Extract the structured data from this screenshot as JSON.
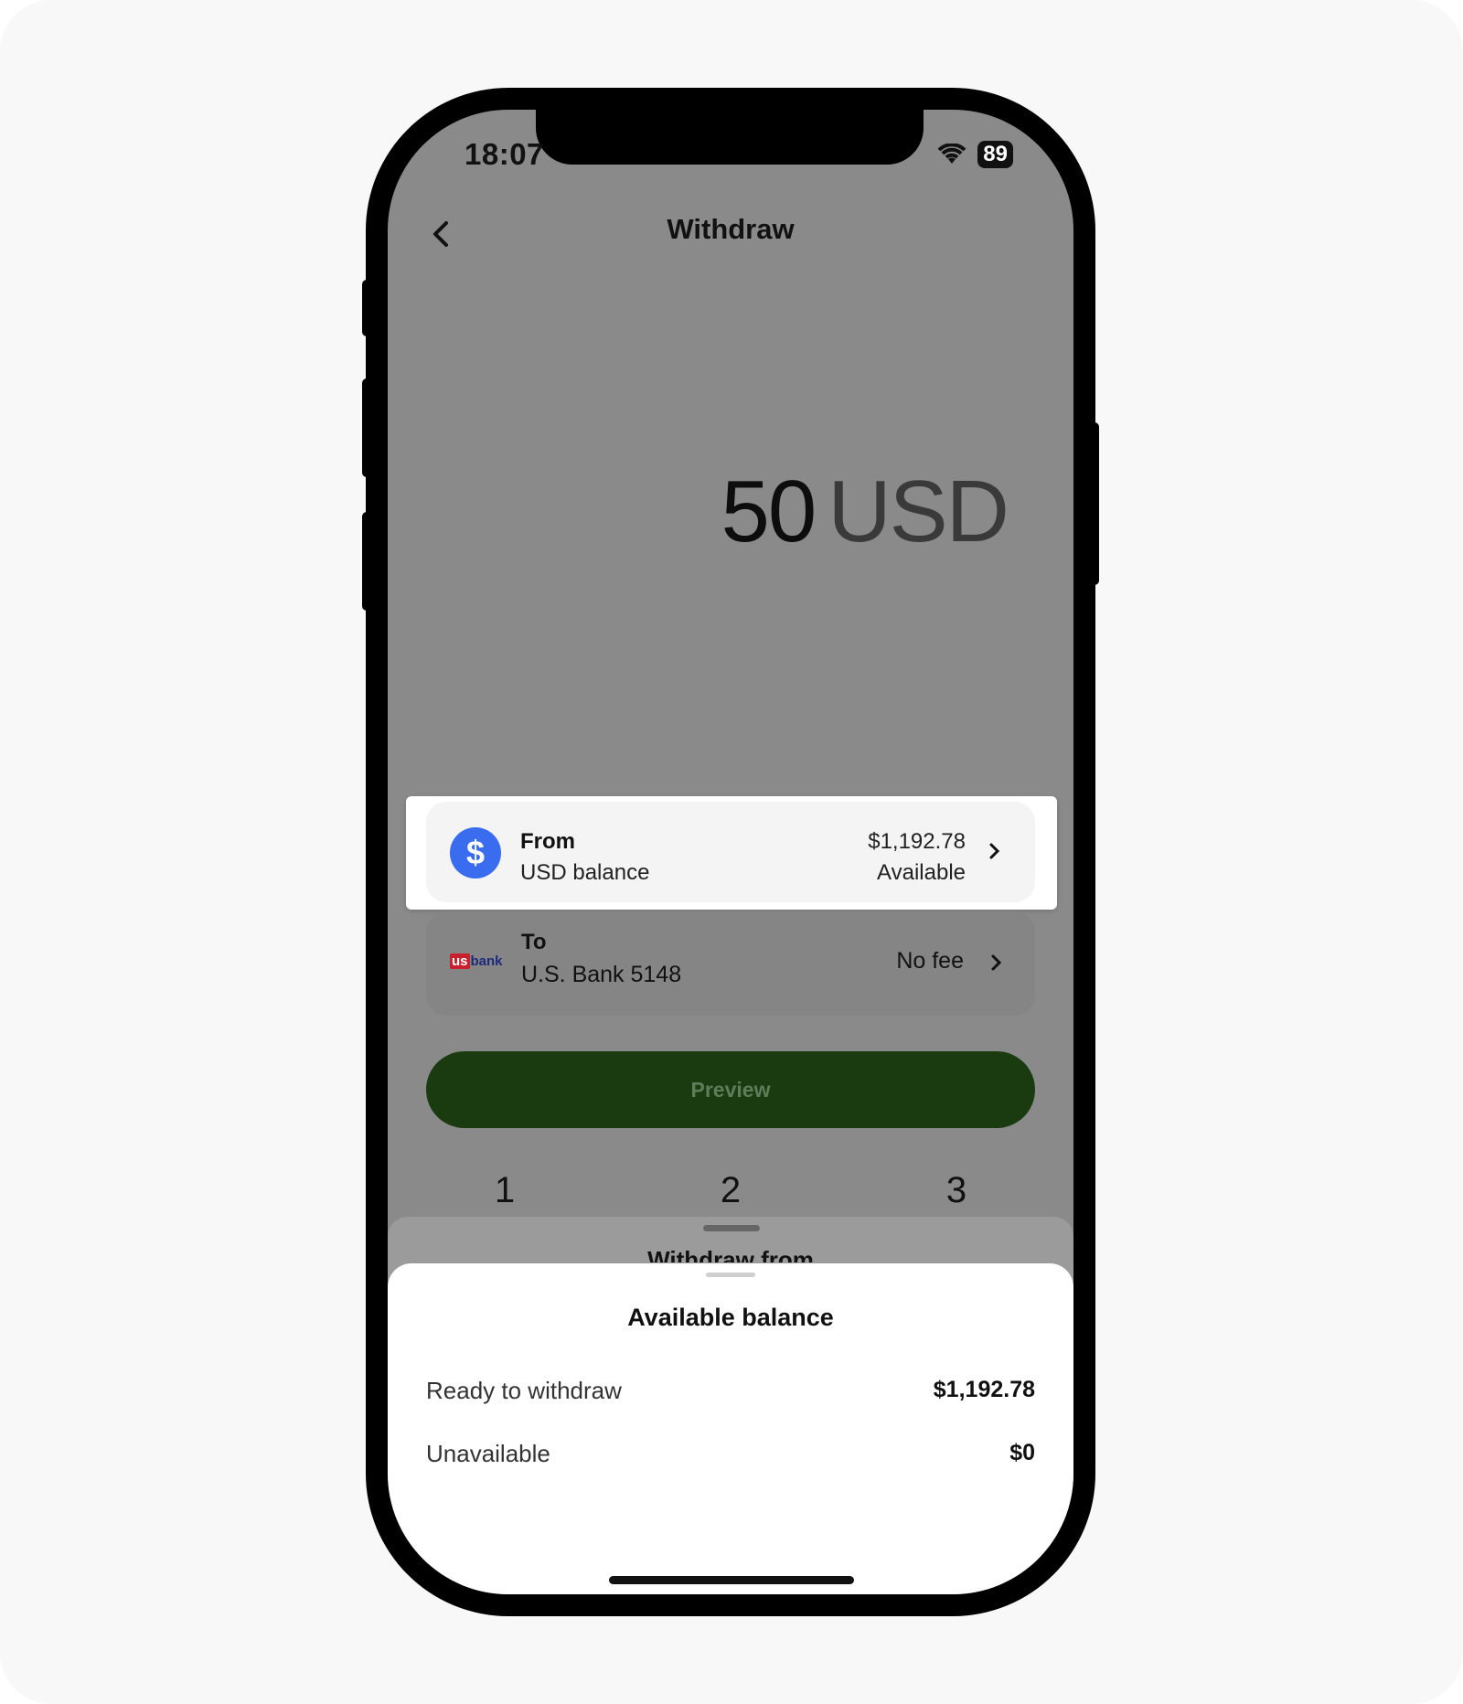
{
  "status_bar": {
    "time": "18:07",
    "battery": "89"
  },
  "header": {
    "title": "Withdraw"
  },
  "amount": {
    "value": "50",
    "currency": "USD"
  },
  "from": {
    "label": "From",
    "account": "USD balance",
    "balance": "$1,192.78",
    "balance_note": "Available",
    "icon_glyph": "$"
  },
  "to": {
    "label": "To",
    "account": "U.S. Bank 5148",
    "fee": "No fee",
    "logo_us": "us",
    "logo_bank": "bank"
  },
  "preview_button": {
    "label": "Preview"
  },
  "keypad": {
    "keys": [
      "1",
      "2",
      "3"
    ]
  },
  "back_sheet": {
    "title": "Withdraw from"
  },
  "sheet": {
    "title": "Available balance",
    "rows": [
      {
        "label": "Ready to withdraw",
        "value": "$1,192.78"
      },
      {
        "label": "Unavailable",
        "value": "$0"
      }
    ]
  },
  "colors": {
    "accent_blue": "#3a6cf0",
    "preview_green": "#1a3b10",
    "overlay_gray": "#8a8a8a"
  }
}
